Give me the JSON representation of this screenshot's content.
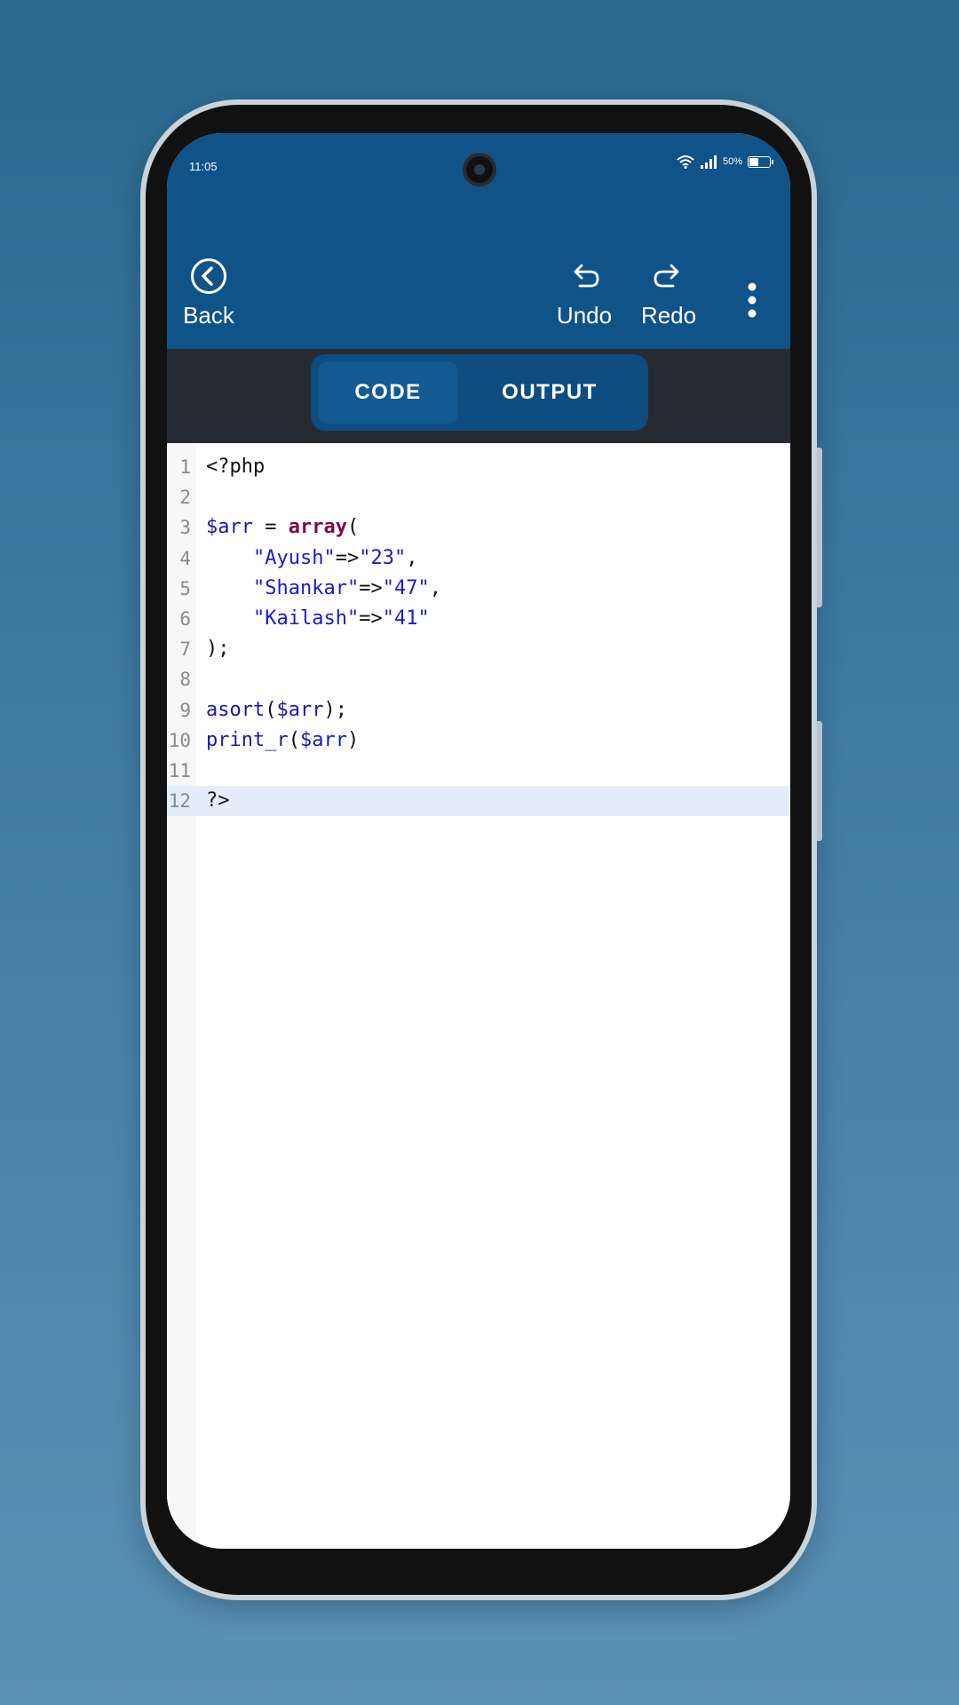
{
  "status_bar": {
    "time": "11:05",
    "battery": "50%",
    "battery_level": 0.5
  },
  "toolbar": {
    "back_label": "Back",
    "undo_label": "Undo",
    "redo_label": "Redo",
    "icons": [
      "chevron-left-circle-icon",
      "undo-arrow-icon",
      "redo-arrow-icon",
      "more-vertical-icon"
    ]
  },
  "tabs": [
    {
      "label": "CODE",
      "active": true
    },
    {
      "label": "OUTPUT",
      "active": false
    }
  ],
  "editor": {
    "current_line": 12,
    "lines": [
      {
        "n": "1",
        "tokens": [
          {
            "t": "<?php",
            "c": "plain"
          }
        ]
      },
      {
        "n": "2",
        "tokens": []
      },
      {
        "n": "3",
        "tokens": [
          {
            "t": "$arr",
            "c": "var"
          },
          {
            "t": " = ",
            "c": "plain"
          },
          {
            "t": "array",
            "c": "kw"
          },
          {
            "t": "(",
            "c": "plain"
          }
        ]
      },
      {
        "n": "4",
        "tokens": [
          {
            "t": "    ",
            "c": "plain"
          },
          {
            "t": "\"Ayush\"",
            "c": "str"
          },
          {
            "t": "=>",
            "c": "plain"
          },
          {
            "t": "\"23\"",
            "c": "str"
          },
          {
            "t": ",",
            "c": "plain"
          }
        ]
      },
      {
        "n": "5",
        "tokens": [
          {
            "t": "    ",
            "c": "plain"
          },
          {
            "t": "\"Shankar\"",
            "c": "str"
          },
          {
            "t": "=>",
            "c": "plain"
          },
          {
            "t": "\"47\"",
            "c": "str"
          },
          {
            "t": ",",
            "c": "plain"
          }
        ]
      },
      {
        "n": "6",
        "tokens": [
          {
            "t": "    ",
            "c": "plain"
          },
          {
            "t": "\"Kailash\"",
            "c": "str"
          },
          {
            "t": "=>",
            "c": "plain"
          },
          {
            "t": "\"41\"",
            "c": "str"
          }
        ]
      },
      {
        "n": "7",
        "tokens": [
          {
            "t": ");",
            "c": "plain"
          }
        ]
      },
      {
        "n": "8",
        "tokens": []
      },
      {
        "n": "9",
        "tokens": [
          {
            "t": "asort",
            "c": "fn"
          },
          {
            "t": "(",
            "c": "plain"
          },
          {
            "t": "$arr",
            "c": "var"
          },
          {
            "t": ");",
            "c": "plain"
          }
        ]
      },
      {
        "n": "10",
        "tokens": [
          {
            "t": "print_r",
            "c": "fn"
          },
          {
            "t": "(",
            "c": "plain"
          },
          {
            "t": "$arr",
            "c": "var"
          },
          {
            "t": ")",
            "c": "plain"
          }
        ]
      },
      {
        "n": "11",
        "tokens": []
      },
      {
        "n": "12",
        "tokens": [
          {
            "t": "?>",
            "c": "plain"
          }
        ]
      }
    ]
  },
  "colors": {
    "app_bar": "#0f5389",
    "tab_bar": "#262b33",
    "segment": "#0f4c80",
    "segment_active": "#135a92",
    "current_line": "#e3eefa"
  }
}
